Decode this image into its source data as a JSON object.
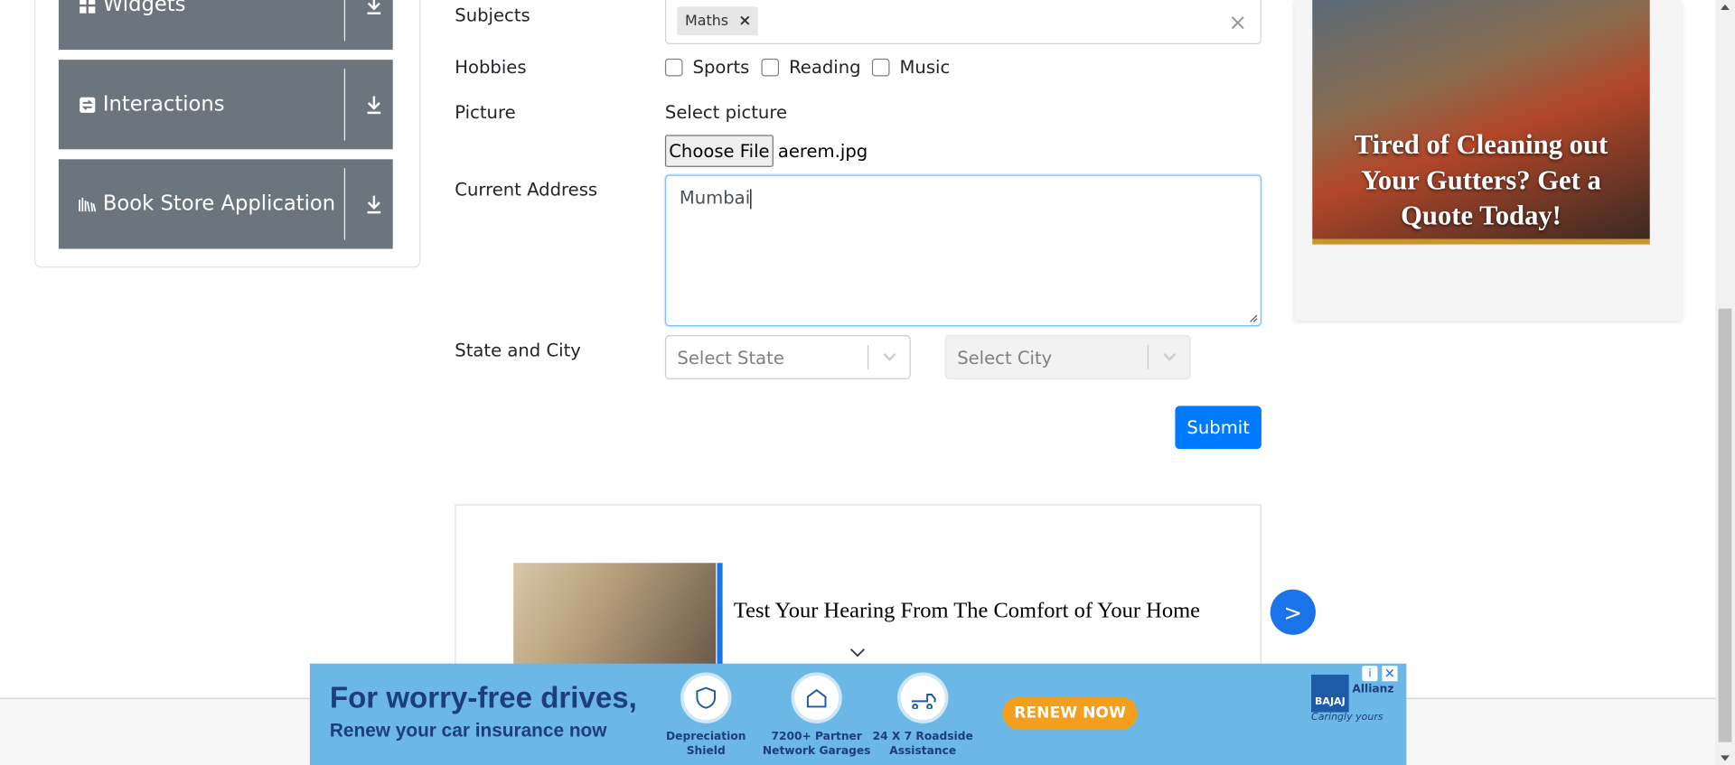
{
  "sidebar": {
    "groups": [
      {
        "label": "Widgets",
        "icon": "widgets-icon"
      },
      {
        "label": "Interactions",
        "icon": "interactions-icon"
      },
      {
        "label": "Book Store Application",
        "icon": "book-store-icon"
      }
    ]
  },
  "form": {
    "subjects_label": "Subjects",
    "subjects_chips": [
      "Maths"
    ],
    "chip_remove": "×",
    "clear_all": "×",
    "hobbies_label": "Hobbies",
    "hobbies": [
      "Sports",
      "Reading",
      "Music"
    ],
    "picture_label": "Picture",
    "select_picture": "Select picture",
    "choose_file": "Choose File",
    "file_name": "aerem.jpg",
    "address_label": "Current Address",
    "address_value": "Mumbai",
    "state_city_label": "State and City",
    "state_placeholder": "Select State",
    "city_placeholder": "Select City",
    "submit": "Submit"
  },
  "ads": {
    "right_headline": "Tired of Cleaning out Your Gutters? Get a Quote Today!",
    "inline_text": "Test Your Hearing From The Comfort of Your Home",
    "next": ">",
    "banner_title": "For worry-free drives,",
    "banner_sub": "Renew your car insurance now",
    "features": [
      "Depreciation Shield",
      "7200+ Partner Network Garages",
      "24 X 7 Roadside Assistance"
    ],
    "renew": "RENEW NOW",
    "brand": "BAJAJ",
    "brand2": "Allianz",
    "tagline": "Caringly yours",
    "info": "i",
    "close": "✕"
  },
  "colors": {
    "primary": "#007bff",
    "sidebar_bg": "#6c757d",
    "banner_bg": "#6bb7e6"
  }
}
